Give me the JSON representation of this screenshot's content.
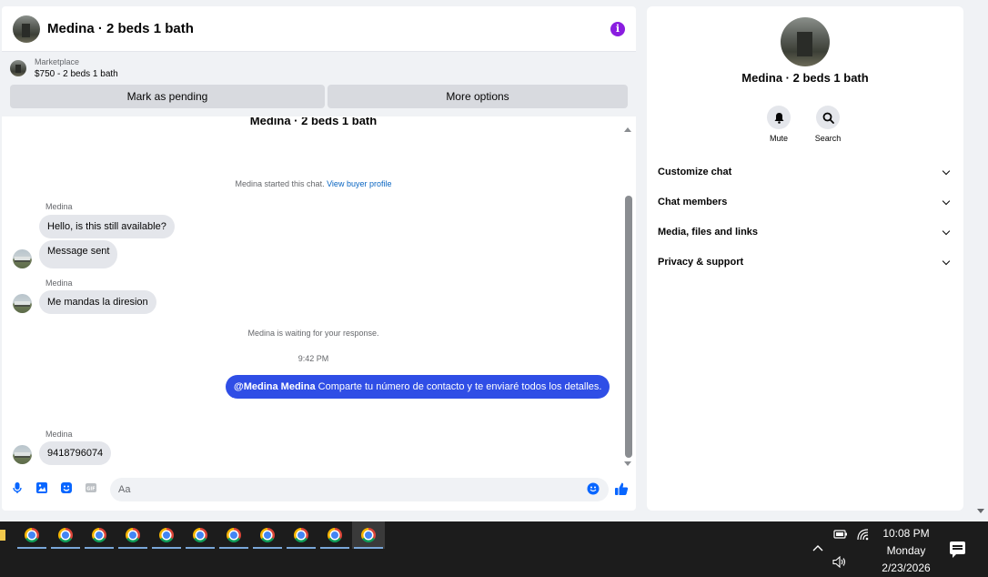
{
  "chat": {
    "header_title": "Medina · 2 beds 1 bath",
    "listing": {
      "label": "Marketplace",
      "price_line": "$750 - 2 beds 1 bath",
      "pending_button": "Mark as pending",
      "more_button": "More options"
    },
    "conversation_title": "Medina · 2 beds 1 bath",
    "started_text": "Medina started this chat.",
    "buyer_profile_link": "View buyer profile",
    "messages": [
      {
        "sender": "Medina",
        "text": "Hello, is this still available?"
      },
      {
        "text": "Message sent"
      },
      {
        "sender": "Medina",
        "text": "Me mandas la diresion"
      },
      {
        "text": "Medina is waiting for your response."
      },
      {
        "text": "9:42 PM"
      },
      {
        "mention": "@Medina Medina",
        "text": " Comparte tu número de contacto y te enviaré todos los detalles."
      },
      {
        "sender": "Medina",
        "text": "9418796074"
      }
    ],
    "composer_placeholder": "Aa"
  },
  "info": {
    "title": "Medina · 2 beds 1 bath",
    "mute_label": "Mute",
    "search_label": "Search",
    "sections": [
      "Customize chat",
      "Chat members",
      "Media, files and links",
      "Privacy & support"
    ]
  },
  "taskbar": {
    "time": "10:08 PM",
    "day": "Monday",
    "date": "2/23/2026"
  },
  "colors": {
    "accent_purple": "#8a1de0",
    "outgoing_bubble": "#2f4ee6",
    "link": "#0a66c2"
  }
}
